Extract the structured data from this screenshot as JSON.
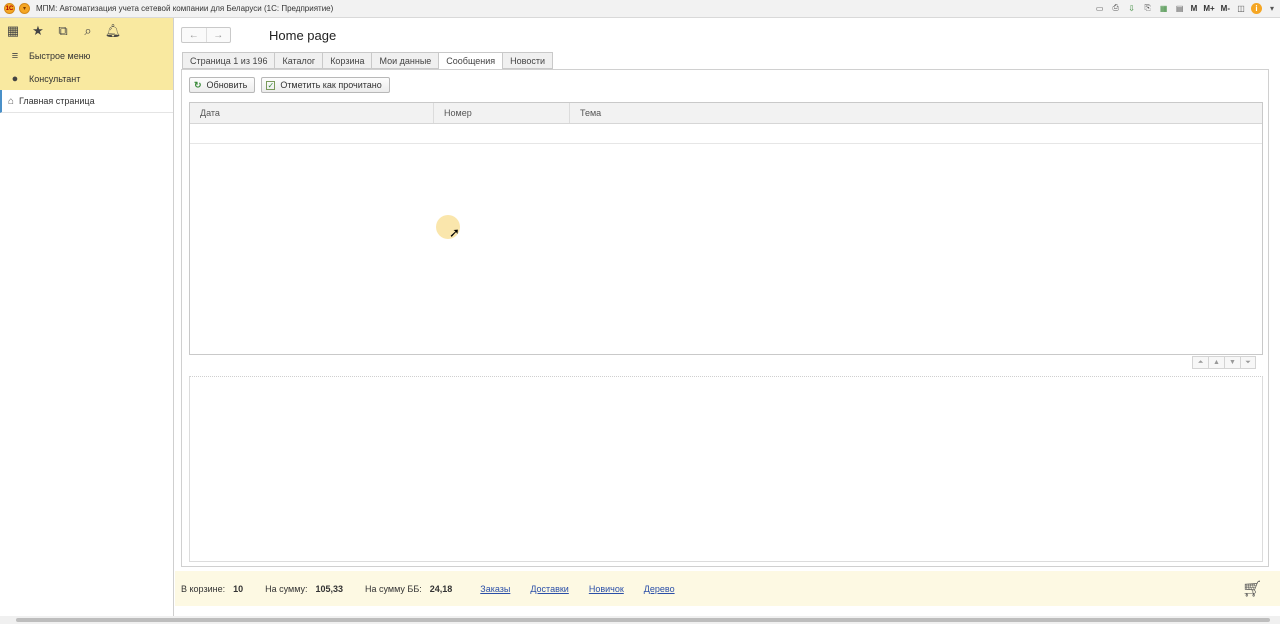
{
  "window": {
    "logo": "1С",
    "title": "МПМ: Автоматизация учета сетевой компании для Беларуси   (1С: Предприятие)",
    "toolbar_icons": [
      "save-icon",
      "print-icon",
      "download-icon",
      "print-preview-icon",
      "spreadsheet-icon",
      "calendar-icon",
      "calculator-icon"
    ],
    "memory_labels": [
      "M",
      "M+",
      "M-"
    ]
  },
  "sidebar": {
    "top_icons": [
      "apps-grid-icon",
      "star-icon",
      "history-icon",
      "search-icon",
      "bell-icon"
    ],
    "items": [
      {
        "label": "Быстрое меню",
        "icon": "menu-icon"
      },
      {
        "label": "Консультант",
        "icon": "person-icon"
      }
    ],
    "home": {
      "label": "Главная страница",
      "icon": "home-icon"
    }
  },
  "main": {
    "page_title": "Home page",
    "tabs": [
      {
        "label": "Страница 1 из 196",
        "active": false
      },
      {
        "label": "Каталог",
        "active": false
      },
      {
        "label": "Корзина",
        "active": false
      },
      {
        "label": "Мои данные",
        "active": false
      },
      {
        "label": "Сообщения",
        "active": true
      },
      {
        "label": "Новости",
        "active": false
      }
    ],
    "toolbar": {
      "refresh_label": "Обновить",
      "mark_read_label": "Отметить как прочитано"
    },
    "grid": {
      "columns": [
        "Дата",
        "Номер",
        "Тема"
      ],
      "rows": []
    }
  },
  "statusbar": {
    "cart_label": "В корзине:",
    "cart_value": "10",
    "sum_label": "На сумму:",
    "sum_value": "105,33",
    "bb_label": "На сумму ББ:",
    "bb_value": "24,18",
    "links": [
      "Заказы",
      "Доставки",
      "Новичок",
      "Дерево"
    ]
  },
  "colors": {
    "sidebar_accent": "#f9e9a0",
    "statusbar_bg": "#fdf9e3",
    "link": "#2b4fa8"
  }
}
